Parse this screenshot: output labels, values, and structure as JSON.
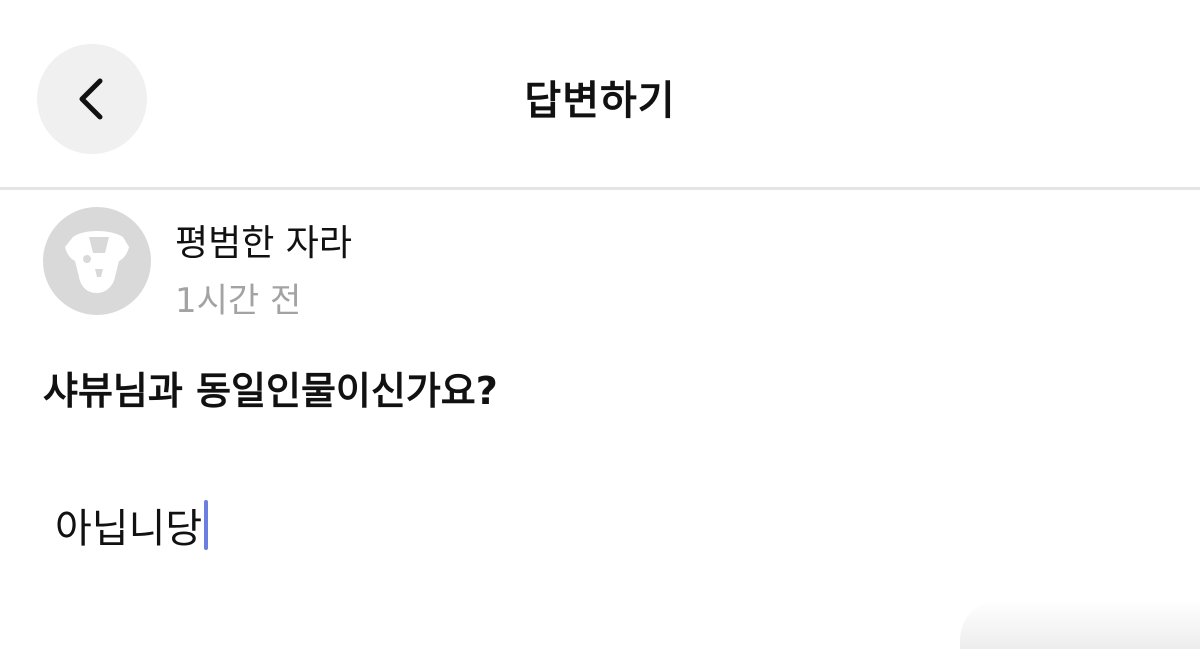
{
  "header": {
    "title": "답변하기",
    "back_icon": "chevron-left-icon"
  },
  "post": {
    "author": "평범한 자라",
    "time": "1시간 전",
    "avatar_icon": "default-avatar-icon",
    "question": "샤뷰님과 동일인물이신가요?"
  },
  "answer": {
    "value": "아닙니당"
  },
  "colors": {
    "background": "#ffffff",
    "back_button_bg": "#f0f0f0",
    "divider": "#e4e4e4",
    "avatar_bg": "#d9d9d9",
    "muted_text": "#a3a3a3",
    "cursor": "#6b7fe0"
  }
}
